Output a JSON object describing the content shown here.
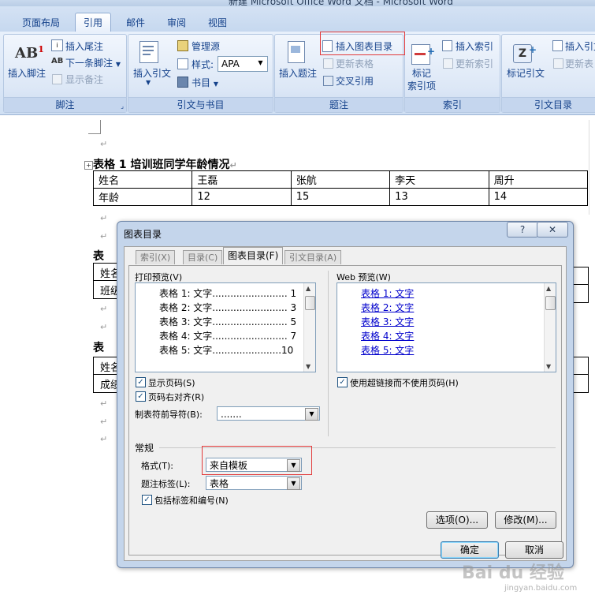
{
  "window": {
    "title": "新建 Microsoft Office Word 文档 - Microsoft Word"
  },
  "ribbon_tabs": [
    "页面布局",
    "引用",
    "邮件",
    "审阅",
    "视图"
  ],
  "active_tab": "引用",
  "ribbon": {
    "footnotes": {
      "label": "脚注",
      "insert_footnote": "插入脚注",
      "insert_endnote": "插入尾注",
      "next_footnote": "下一条脚注",
      "show_notes": "显示备注"
    },
    "citations": {
      "label": "引文与书目",
      "insert_citation": "插入引文",
      "manage_sources": "管理源",
      "style_label": "样式:",
      "style_value": "APA",
      "bibliography": "书目"
    },
    "captions": {
      "label": "题注",
      "insert_caption": "插入题注",
      "insert_table_of_figures": "插入图表目录",
      "update_table": "更新表格",
      "cross_reference": "交叉引用"
    },
    "index": {
      "label": "索引",
      "mark_entry": "标记\n索引项",
      "mark_entry_line1": "标记",
      "mark_entry_line2": "索引项",
      "insert_index": "插入索引",
      "update_index": "更新索引"
    },
    "toa": {
      "label": "引文目录",
      "mark_citation": "标记引文",
      "insert_toa": "插入引文",
      "update_toa": "更新表"
    }
  },
  "document": {
    "return_mark": "↵",
    "caption1": "表格 1 培训班同学年龄情况",
    "table1": {
      "rows": [
        [
          "姓名",
          "王磊",
          "张航",
          "李天",
          "周升"
        ],
        [
          "年龄",
          "12",
          "15",
          "13",
          "14"
        ]
      ]
    },
    "caption2_partial": "表",
    "table2_cells": [
      "姓名",
      "班级"
    ],
    "caption3_partial": "表",
    "table3_cells": [
      "姓名",
      "成绩"
    ]
  },
  "dialog": {
    "title": "图表目录",
    "help_btn": "?",
    "close_btn": "✕",
    "tabs": [
      "索引(X)",
      "目录(C)",
      "图表目录(F)",
      "引文目录(A)"
    ],
    "active_tab": "图表目录(F)",
    "print_preview_label": "打印预览(V)",
    "print_preview_rows": [
      "表格 1: 文字......................... 1",
      "表格 2: 文字......................... 3",
      "表格 3: 文字......................... 5",
      "表格 4: 文字......................... 7",
      "表格 5: 文字.......................10"
    ],
    "web_preview_label": "Web 预览(W)",
    "web_preview_rows": [
      "表格 1: 文字",
      "表格 2: 文字",
      "表格 3: 文字",
      "表格 4: 文字",
      "表格 5: 文字"
    ],
    "show_page_numbers": "显示页码(S)",
    "right_align": "页码右对齐(R)",
    "use_hyperlinks": "使用超链接而不使用页码(H)",
    "tab_leader_label": "制表符前导符(B):",
    "tab_leader_value": ".......",
    "general_label": "常规",
    "format_label": "格式(T):",
    "format_value": "来自模板",
    "caption_label_label": "题注标签(L):",
    "caption_label_value": "表格",
    "include_label": "包括标签和编号(N)",
    "options_btn": "选项(O)...",
    "modify_btn": "修改(M)...",
    "ok_btn": "确定",
    "cancel_btn": "取消",
    "check_mark": "✓",
    "dropdown_glyph": "▼",
    "scroll_up_glyph": "▲",
    "scroll_down_glyph": "▼"
  },
  "watermark": {
    "brand": "Bai du 经验",
    "url": "jingyan.baidu.com"
  },
  "colors": {
    "ribbon_blue": "#15428b",
    "highlight_red": "#e23a3a",
    "link_blue": "#0000cc"
  }
}
